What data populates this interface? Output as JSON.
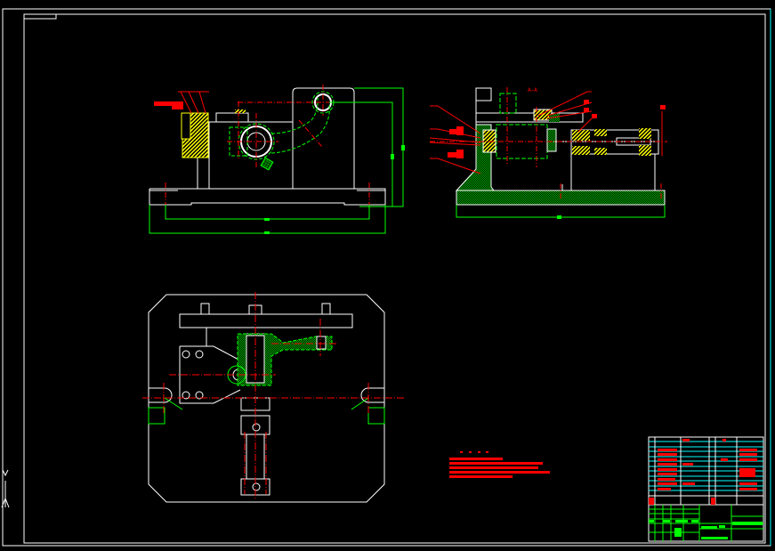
{
  "drawing": {
    "section_label": "A—A",
    "colors": {
      "background": "#000000",
      "outline": "#ffffff",
      "centerline": "#ff0000",
      "dimension": "#00ff00",
      "hatch_steel": "#ffff00",
      "hatch_cast": "#00c000",
      "table_lines": "#00ffff"
    }
  }
}
